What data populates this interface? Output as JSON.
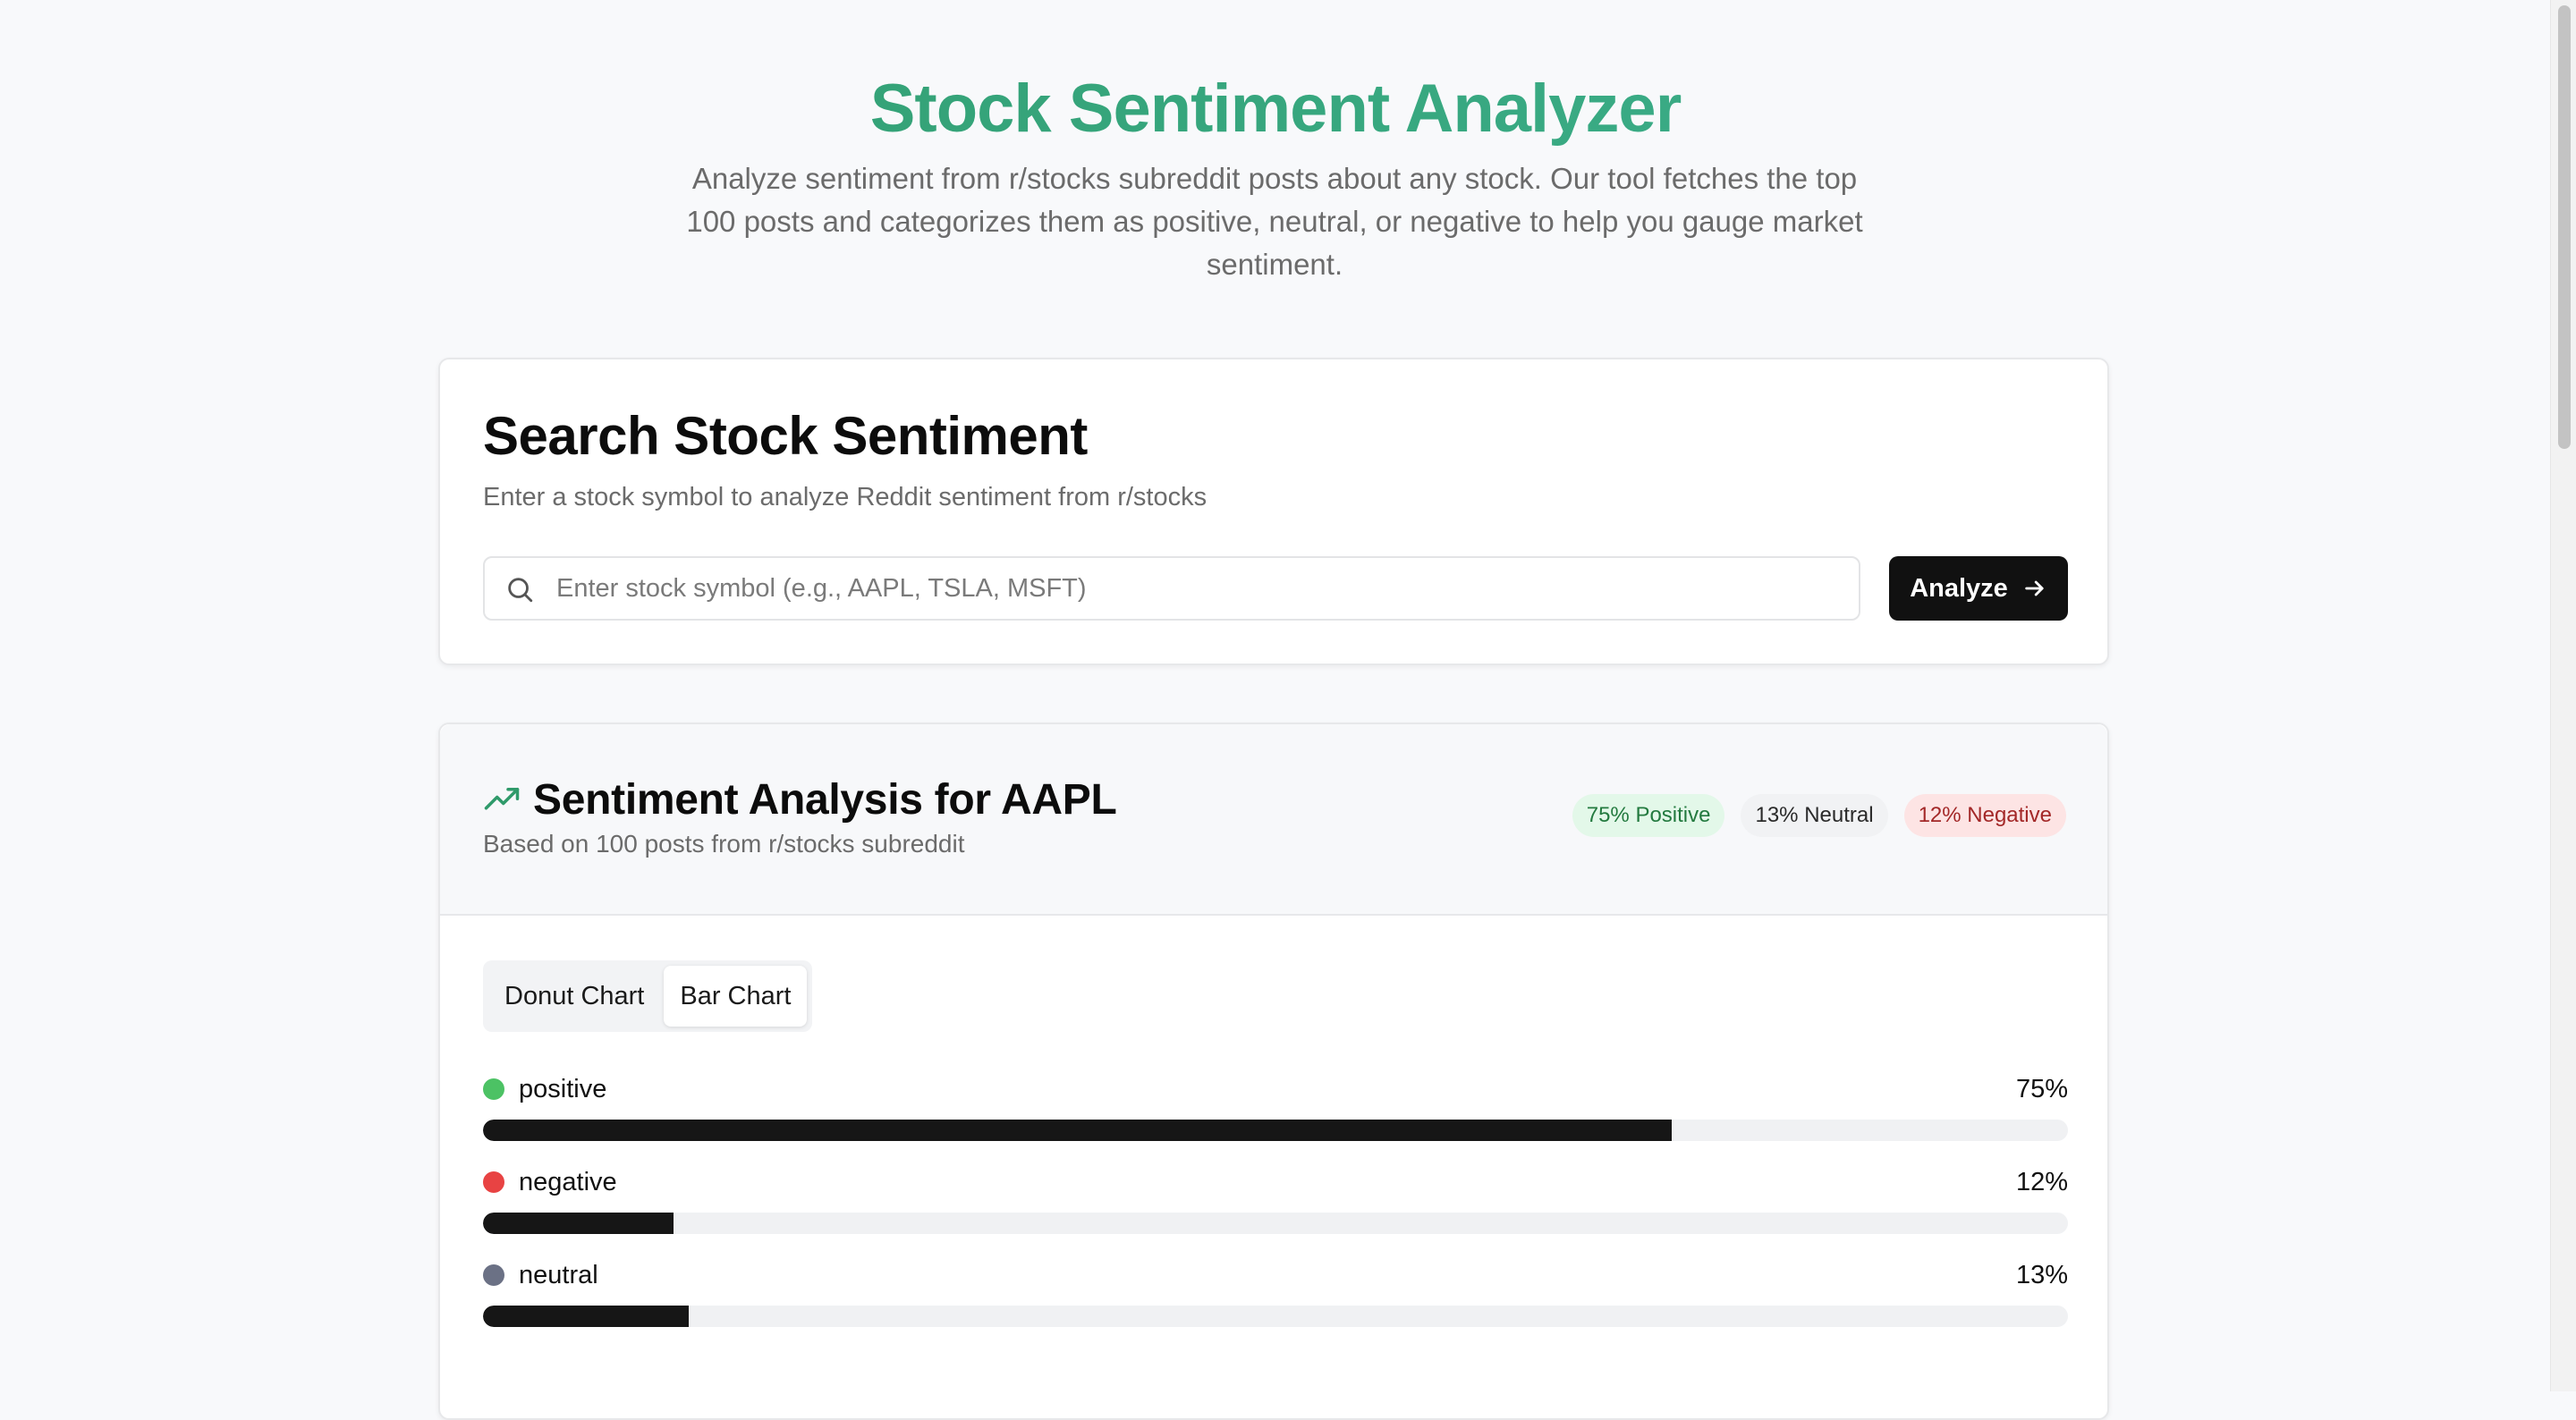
{
  "header": {
    "title": "Stock Sentiment Analyzer",
    "description": "Analyze sentiment from r/stocks subreddit posts about any stock. Our tool fetches the top 100 posts and categorizes them as positive, neutral, or negative to help you gauge market sentiment."
  },
  "search": {
    "title": "Search Stock Sentiment",
    "subtitle": "Enter a stock symbol to analyze Reddit sentiment from r/stocks",
    "placeholder": "Enter stock symbol (e.g., AAPL, TSLA, MSFT)",
    "value": "",
    "button_label": "Analyze",
    "search_icon": "search-icon",
    "button_icon": "arrow-right-icon"
  },
  "results": {
    "title": "Sentiment Analysis for AAPL",
    "subtitle": "Based on 100 posts from r/stocks subreddit",
    "icon": "trending-up-icon",
    "badges": {
      "positive": "75% Positive",
      "neutral": "13% Neutral",
      "negative": "12% Negative"
    },
    "tabs": [
      {
        "label": "Donut Chart",
        "active": false
      },
      {
        "label": "Bar Chart",
        "active": true
      }
    ]
  },
  "colors": {
    "accent_green": "#2f9a6a",
    "positive_dot": "#4cc264",
    "negative_dot": "#e84343",
    "neutral_dot": "#6b7185",
    "bar_fill": "#161616"
  },
  "chart_data": {
    "type": "bar",
    "categories": [
      "positive",
      "negative",
      "neutral"
    ],
    "values": [
      75,
      12,
      13
    ],
    "value_labels": [
      "75%",
      "12%",
      "13%"
    ],
    "ylim": [
      0,
      100
    ]
  }
}
